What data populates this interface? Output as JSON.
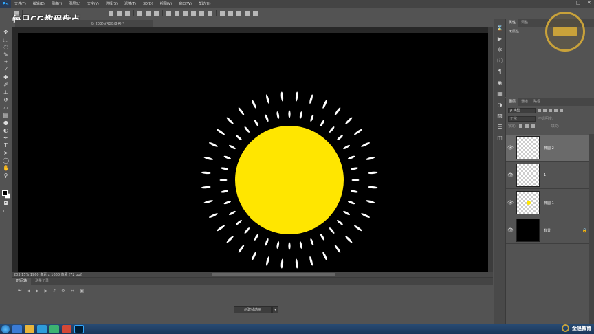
{
  "app": {
    "logo": "Ps",
    "menu": [
      "文件(F)",
      "编辑(E)",
      "图像(I)",
      "图层(L)",
      "文字(Y)",
      "选择(S)",
      "滤镜(T)",
      "3D(D)",
      "视图(V)",
      "窗口(W)",
      "帮助(H)"
    ],
    "window_controls": [
      "—",
      "▢",
      "✕"
    ]
  },
  "watermark": "每日CG教程盘点",
  "document": {
    "tab_label": "@ 203%(RGB/8#) *"
  },
  "status": {
    "text": "203.15%  1960 像素 x 1660 像素 (72 ppi)"
  },
  "timeline": {
    "tabs": [
      "时间轴",
      "测量记录"
    ],
    "create_button": "创建帧动画",
    "dropdown": "▾"
  },
  "properties_panel": {
    "tabs": [
      "属性",
      "调整"
    ],
    "empty_text": "无属性"
  },
  "layers_panel": {
    "tabs": [
      "图层",
      "通道",
      "路径"
    ],
    "filter_label": "ρ 类型",
    "blend_mode": "正常",
    "opacity_label": "不透明度:",
    "lock_label": "锁定:",
    "fill_label": "填充:",
    "layers": [
      {
        "name": "椭圆 2",
        "thumb": "transparent",
        "selected": true
      },
      {
        "name": "1",
        "thumb": "transparent",
        "selected": false
      },
      {
        "name": "椭圆 1",
        "thumb": "transparent-dot",
        "selected": false
      },
      {
        "name": "背景",
        "thumb": "black",
        "selected": false
      }
    ]
  },
  "taskbar": {
    "tray_text": "金晟教育"
  },
  "icons": {
    "tools": [
      "move-icon",
      "marquee-icon",
      "lasso-icon",
      "quick-select-icon",
      "crop-icon",
      "eyedropper-icon",
      "healing-icon",
      "brush-icon",
      "stamp-icon",
      "history-brush-icon",
      "eraser-icon",
      "gradient-icon",
      "blur-icon",
      "dodge-icon",
      "pen-icon",
      "type-icon",
      "path-select-icon",
      "shape-icon",
      "hand-icon",
      "zoom-icon"
    ]
  },
  "colors": {
    "sun": "#ffe600",
    "rays": "#ffffff",
    "canvas": "#000000",
    "ui_bg": "#535353"
  }
}
